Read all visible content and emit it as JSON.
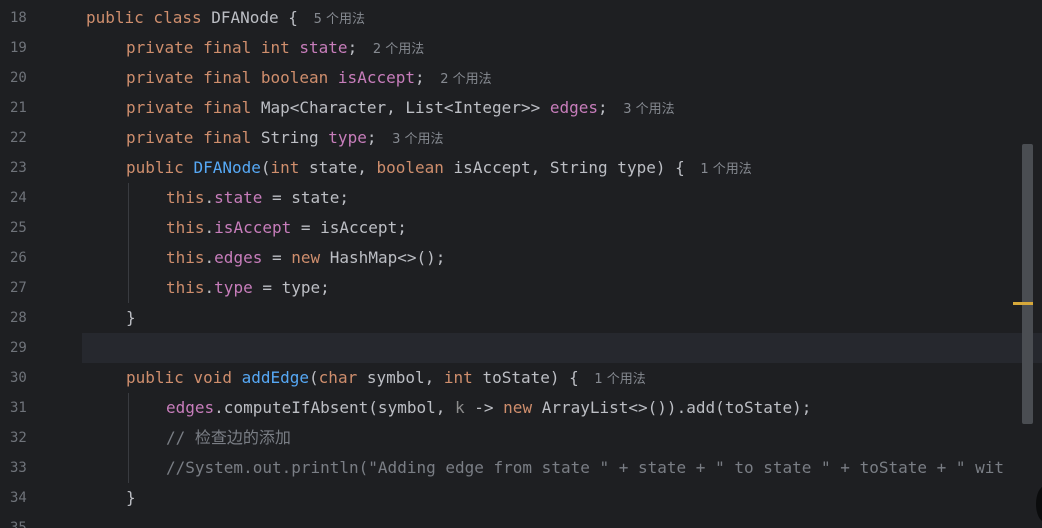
{
  "editor": {
    "lines": [
      {
        "num": "18",
        "tokens": [
          [
            "kw",
            "public class "
          ],
          [
            "",
            "DFANode { "
          ]
        ],
        "hint": "5 个用法"
      },
      {
        "num": "19",
        "tokens": [
          [
            "kw",
            "private final int "
          ],
          [
            "fld",
            "state"
          ],
          [
            "",
            "; "
          ]
        ],
        "hint": "2 个用法"
      },
      {
        "num": "20",
        "tokens": [
          [
            "kw",
            "private final boolean "
          ],
          [
            "fld",
            "isAccept"
          ],
          [
            "",
            "; "
          ]
        ],
        "hint": "2 个用法"
      },
      {
        "num": "21",
        "tokens": [
          [
            "kw",
            "private final "
          ],
          [
            "",
            "Map<Character, List<Integer>> "
          ],
          [
            "fld",
            "edges"
          ],
          [
            "",
            "; "
          ]
        ],
        "hint": "3 个用法"
      },
      {
        "num": "22",
        "tokens": [
          [
            "kw",
            "private final "
          ],
          [
            "",
            "String "
          ],
          [
            "fld",
            "type"
          ],
          [
            "",
            "; "
          ]
        ],
        "hint": "3 个用法"
      },
      {
        "num": "23",
        "tokens": [
          [
            "kw",
            "public "
          ],
          [
            "fn",
            "DFANode"
          ],
          [
            "",
            "("
          ],
          [
            "kw",
            "int "
          ],
          [
            "",
            "state, "
          ],
          [
            "kw",
            "boolean "
          ],
          [
            "",
            "isAccept, String type) { "
          ]
        ],
        "hint": "1 个用法"
      },
      {
        "num": "24",
        "tokens": [
          [
            "kw",
            "this"
          ],
          [
            "",
            "."
          ],
          [
            "fld",
            "state"
          ],
          [
            "",
            " = state;"
          ]
        ],
        "hint": ""
      },
      {
        "num": "25",
        "tokens": [
          [
            "kw",
            "this"
          ],
          [
            "",
            "."
          ],
          [
            "fld",
            "isAccept"
          ],
          [
            "",
            " = isAccept;"
          ]
        ],
        "hint": ""
      },
      {
        "num": "26",
        "tokens": [
          [
            "kw",
            "this"
          ],
          [
            "",
            "."
          ],
          [
            "fld",
            "edges"
          ],
          [
            "",
            " = "
          ],
          [
            "kw",
            "new "
          ],
          [
            "",
            "HashMap<>();"
          ]
        ],
        "hint": ""
      },
      {
        "num": "27",
        "tokens": [
          [
            "kw",
            "this"
          ],
          [
            "",
            "."
          ],
          [
            "fld",
            "type"
          ],
          [
            "",
            " = type;"
          ]
        ],
        "hint": ""
      },
      {
        "num": "28",
        "tokens": [
          [
            "",
            "}"
          ]
        ],
        "hint": ""
      },
      {
        "num": "29",
        "tokens": [],
        "hint": ""
      },
      {
        "num": "30",
        "tokens": [
          [
            "kw",
            "public void "
          ],
          [
            "fn",
            "addEdge"
          ],
          [
            "",
            "("
          ],
          [
            "kw",
            "char "
          ],
          [
            "",
            "symbol, "
          ],
          [
            "kw",
            "int "
          ],
          [
            "",
            "toState) { "
          ]
        ],
        "hint": "1 个用法"
      },
      {
        "num": "31",
        "tokens": [
          [
            "fld",
            "edges"
          ],
          [
            "",
            ".computeIfAbsent(symbol, "
          ],
          [
            "lam",
            "k"
          ],
          [
            "",
            " -> "
          ],
          [
            "kw",
            "new "
          ],
          [
            "",
            "ArrayList<>()).add(toState);"
          ]
        ],
        "hint": ""
      },
      {
        "num": "32",
        "tokens": [
          [
            "cm",
            "// 检查边的添加"
          ]
        ],
        "hint": ""
      },
      {
        "num": "33",
        "tokens": [
          [
            "cm",
            "//System.out.println(\"Adding edge from state \" + state + \" to state \" + toState + \" wit"
          ]
        ],
        "hint": ""
      },
      {
        "num": "34",
        "tokens": [
          [
            "",
            "}"
          ]
        ],
        "hint": ""
      },
      {
        "num": "35",
        "tokens": [],
        "hint": ""
      }
    ],
    "indents": [
      0,
      1,
      1,
      1,
      1,
      1,
      2,
      2,
      2,
      2,
      1,
      0,
      1,
      2,
      2,
      2,
      1,
      0
    ],
    "current_line": "29"
  }
}
